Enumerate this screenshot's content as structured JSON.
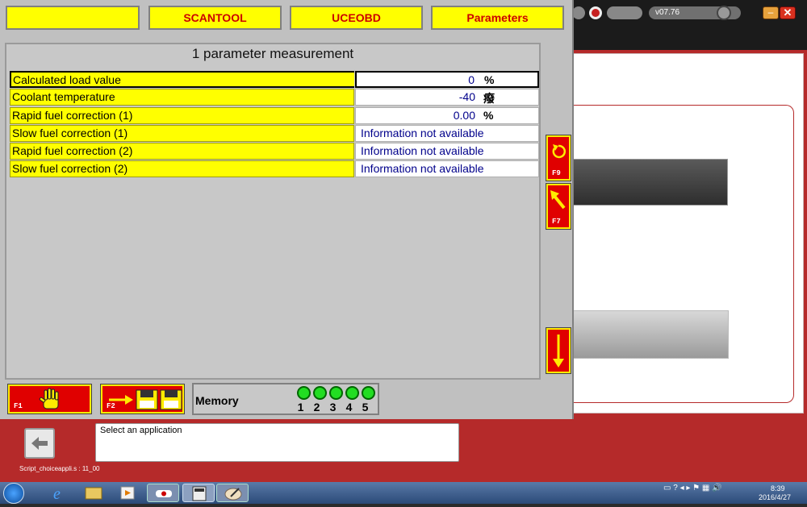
{
  "version": "v07.76",
  "tabs": [
    "",
    "SCANTOOL",
    "UCEOBD",
    "Parameters"
  ],
  "panel": {
    "title": "1 parameter measurement"
  },
  "parameters": [
    {
      "label": "Calculated load value",
      "value": "0",
      "unit": "%"
    },
    {
      "label": "Coolant temperature",
      "value": "-40",
      "unit": "癈"
    },
    {
      "label": "Rapid fuel correction (1)",
      "value": "0.00",
      "unit": "%"
    },
    {
      "label": "Slow fuel correction (1)",
      "info": "Information not available"
    },
    {
      "label": "Rapid fuel correction (2)",
      "info": "Information not available"
    },
    {
      "label": "Slow fuel correction (2)",
      "info": "Information not available"
    }
  ],
  "side_buttons": {
    "f9": "F9",
    "f7": "F7"
  },
  "bottom_buttons": {
    "f1": "F1",
    "f2": "F2"
  },
  "memory": {
    "label": "Memory",
    "slots": [
      "1",
      "2",
      "3",
      "4",
      "5"
    ]
  },
  "status": {
    "text": "Select an application",
    "script": "Script_choiceappli.s : 11_00"
  },
  "taskbar": {
    "time": "8:39",
    "date": "2016/4/27"
  },
  "colors": {
    "tab_bg": "#ffff00",
    "tab_text": "#cc0000",
    "button_red": "#e00000",
    "value_blue": "#00008b",
    "memory_led": "#22dd22"
  }
}
